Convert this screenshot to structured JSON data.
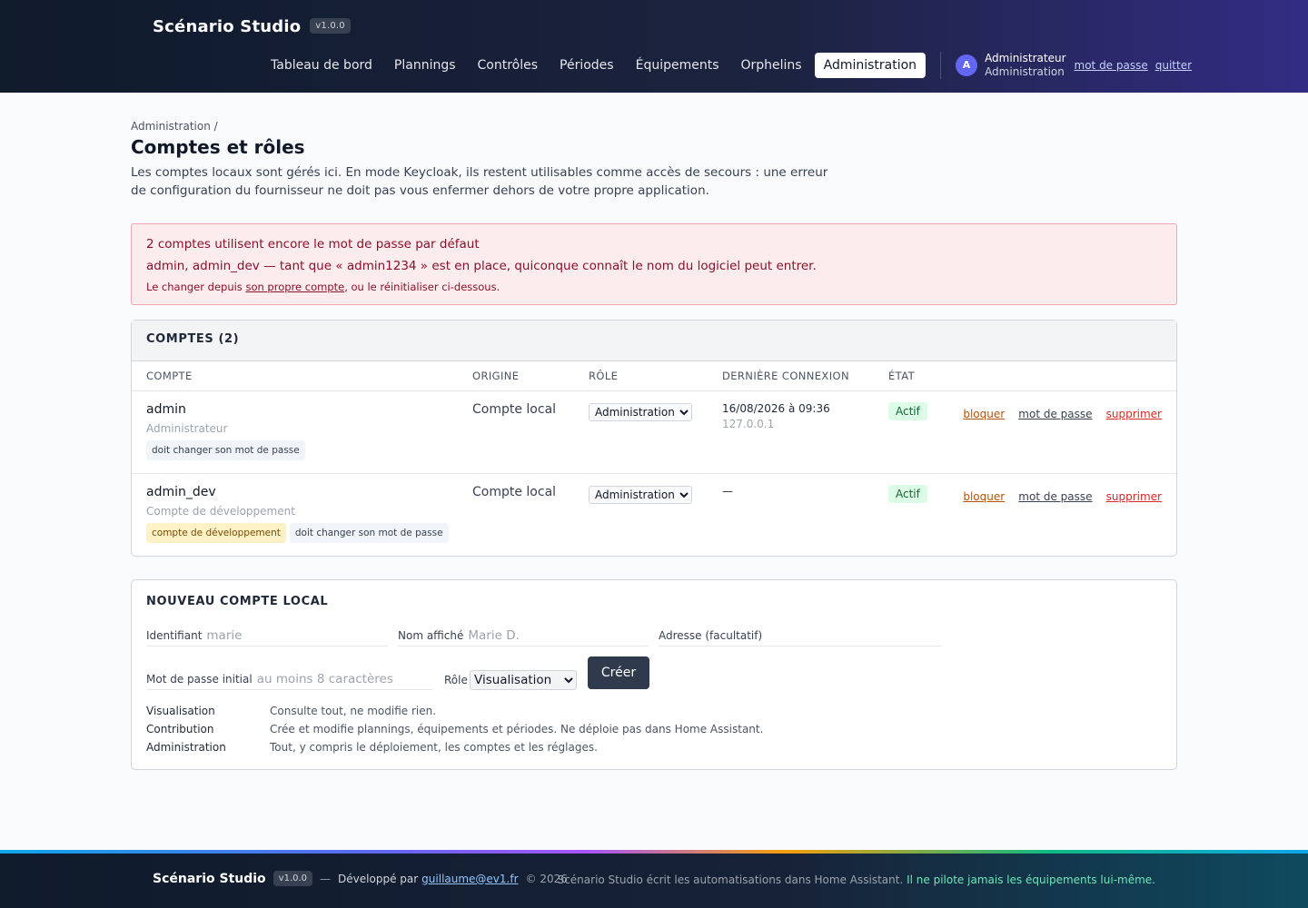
{
  "header": {
    "brand": "Scénario Studio",
    "version": "v1.0.0",
    "nav": [
      "Tableau de bord",
      "Plannings",
      "Contrôles",
      "Périodes",
      "Équipements",
      "Orphelins",
      "Administration"
    ],
    "active_nav": "Administration",
    "user_initial": "A",
    "user_name": "Administrateur",
    "user_role": "Administration",
    "password_link": "mot de passe",
    "logout_link": "quitter"
  },
  "page": {
    "breadcrumb": "Administration /",
    "title": "Comptes et rôles",
    "intro": "Les comptes locaux sont gérés ici. En mode Keycloak, ils restent utilisables comme accès de secours : une erreur de configuration du fournisseur ne doit pas vous enfermer dehors de votre propre application."
  },
  "alert": {
    "line1": "2 comptes utilisent encore le mot de passe par défaut",
    "line2": "admin, admin_dev — tant que « admin1234 » est en place, quiconque connaît le nom du logiciel peut entrer.",
    "line3_pre": "Le changer depuis ",
    "line3_link": "son propre compte",
    "line3_post": ", ou le réinitialiser ci-dessous."
  },
  "accounts": {
    "header": "COMPTES (2)",
    "columns": [
      "COMPTE",
      "ORIGINE",
      "RÔLE",
      "DERNIÈRE CONNEXION",
      "ÉTAT"
    ],
    "rows": [
      {
        "name": "admin",
        "display": "Administrateur",
        "tags": [
          {
            "text": "doit changer son mot de passe",
            "kind": "neutral"
          }
        ],
        "origin": "Compte local",
        "role": "Administration",
        "last_login": "16/08/2026 à 09:36",
        "ip": "127.0.0.1",
        "status": "Actif"
      },
      {
        "name": "admin_dev",
        "display": "Compte de développement",
        "tags": [
          {
            "text": "compte de développement",
            "kind": "dev"
          },
          {
            "text": "doit changer son mot de passe",
            "kind": "neutral"
          }
        ],
        "origin": "Compte local",
        "role": "Administration",
        "last_login": "—",
        "ip": "",
        "status": "Actif"
      }
    ],
    "actions": {
      "block": "bloquer",
      "password": "mot de passe",
      "delete": "supprimer"
    },
    "role_options": [
      "Visualisation",
      "Contribution",
      "Administration"
    ]
  },
  "new_account": {
    "title": "NOUVEAU COMPTE LOCAL",
    "id_label": "Identifiant",
    "id_placeholder": "marie",
    "display_label": "Nom affiché",
    "display_placeholder": "Marie D.",
    "address_label": "Adresse (facultatif)",
    "password_label": "Mot de passe initial",
    "password_placeholder": "au moins 8 caractères",
    "role_label": "Rôle",
    "role_value": "Visualisation",
    "create_button": "Créer",
    "legend": [
      {
        "role": "Visualisation",
        "desc": "Consulte tout, ne modifie rien."
      },
      {
        "role": "Contribution",
        "desc": "Crée et modifie plannings, équipements et périodes. Ne déploie pas dans Home Assistant."
      },
      {
        "role": "Administration",
        "desc": "Tout, y compris le déploiement, les comptes et les réglages."
      }
    ]
  },
  "footer": {
    "brand": "Scénario Studio",
    "version": "v1.0.0",
    "dev_text": "Développé par",
    "email": "guillaume@ev1.fr",
    "copyright": "© 2026",
    "note": "Scénario Studio écrit les automatisations dans Home Assistant.",
    "note_highlight": "Il ne pilote jamais les équipements lui-même."
  }
}
